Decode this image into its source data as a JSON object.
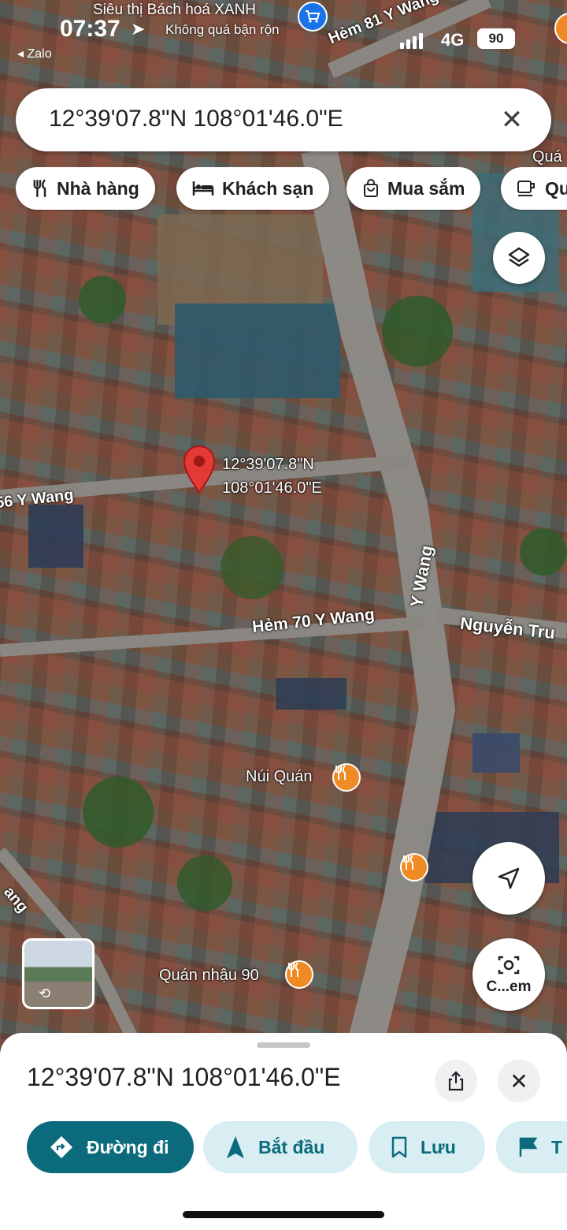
{
  "status_bar": {
    "time": "07:37",
    "back_app": "◂ Zalo",
    "network": "4G",
    "battery": "90",
    "place_name": "Siêu thị Bách hoá XANH",
    "place_sub": "Không quá bận rộn"
  },
  "search": {
    "value": "12°39'07.8\"N 108°01'46.0\"E",
    "close_icon": "close-icon"
  },
  "chips": [
    {
      "icon": "restaurant-icon",
      "label": "Nhà hàng"
    },
    {
      "icon": "hotel-icon",
      "label": "Khách sạn"
    },
    {
      "icon": "shopping-icon",
      "label": "Mua sắm"
    },
    {
      "icon": "cafe-icon",
      "label": "Qu"
    }
  ],
  "map": {
    "pin_label_line1": "12°39'07.8\"N",
    "pin_label_line2": "108°01'46.0\"E",
    "streets": {
      "hem81": "Hẻm 81 Y Wang",
      "hem56": "56 Y Wang",
      "hem70": "Hẻm 70 Y Wang",
      "ywang": "Y Wang",
      "nguyen": "Nguyễn Tru",
      "ang": "ang",
      "quan_top": "Quá"
    },
    "pois": [
      {
        "name": "Núi Quán",
        "icon": "restaurant-icon"
      },
      {
        "name": "Quán nhậu 90",
        "icon": "restaurant-icon"
      }
    ],
    "lens_label": "C...em"
  },
  "sheet": {
    "title": "12°39'07.8\"N 108°01'46.0\"E",
    "actions": [
      {
        "label": "Đường đi",
        "icon": "directions-icon"
      },
      {
        "label": "Bắt đầu",
        "icon": "navigation-icon"
      },
      {
        "label": "Lưu",
        "icon": "bookmark-icon"
      },
      {
        "label": "T",
        "icon": "flag-icon"
      }
    ]
  },
  "colors": {
    "primary": "#0b6b7c",
    "secondary": "#d8eef2",
    "pin": "#e53935",
    "poi": "#f08a24"
  }
}
